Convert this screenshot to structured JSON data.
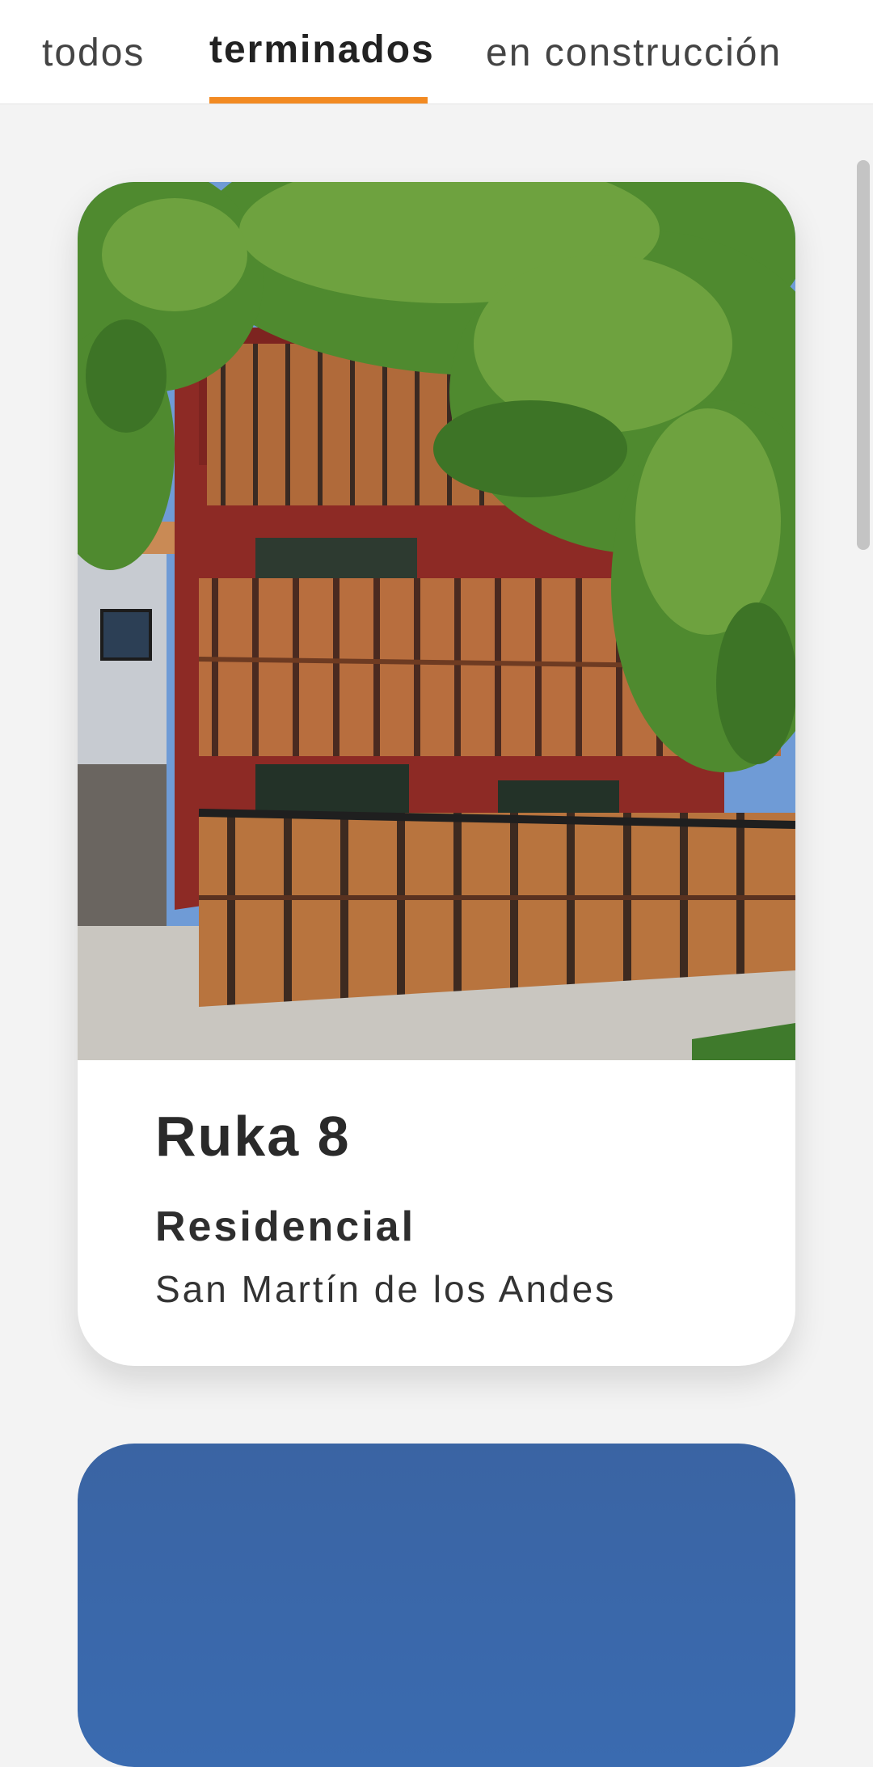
{
  "tabs": [
    {
      "label": "todos",
      "active": false
    },
    {
      "label": "terminados",
      "active": true
    },
    {
      "label": "en construcción",
      "active": false
    }
  ],
  "colors": {
    "accent": "#f28a22",
    "background": "#f3f3f3"
  },
  "projects": [
    {
      "title": "Ruka 8",
      "type": "Residencial",
      "location": "San Martín de los Andes"
    }
  ]
}
